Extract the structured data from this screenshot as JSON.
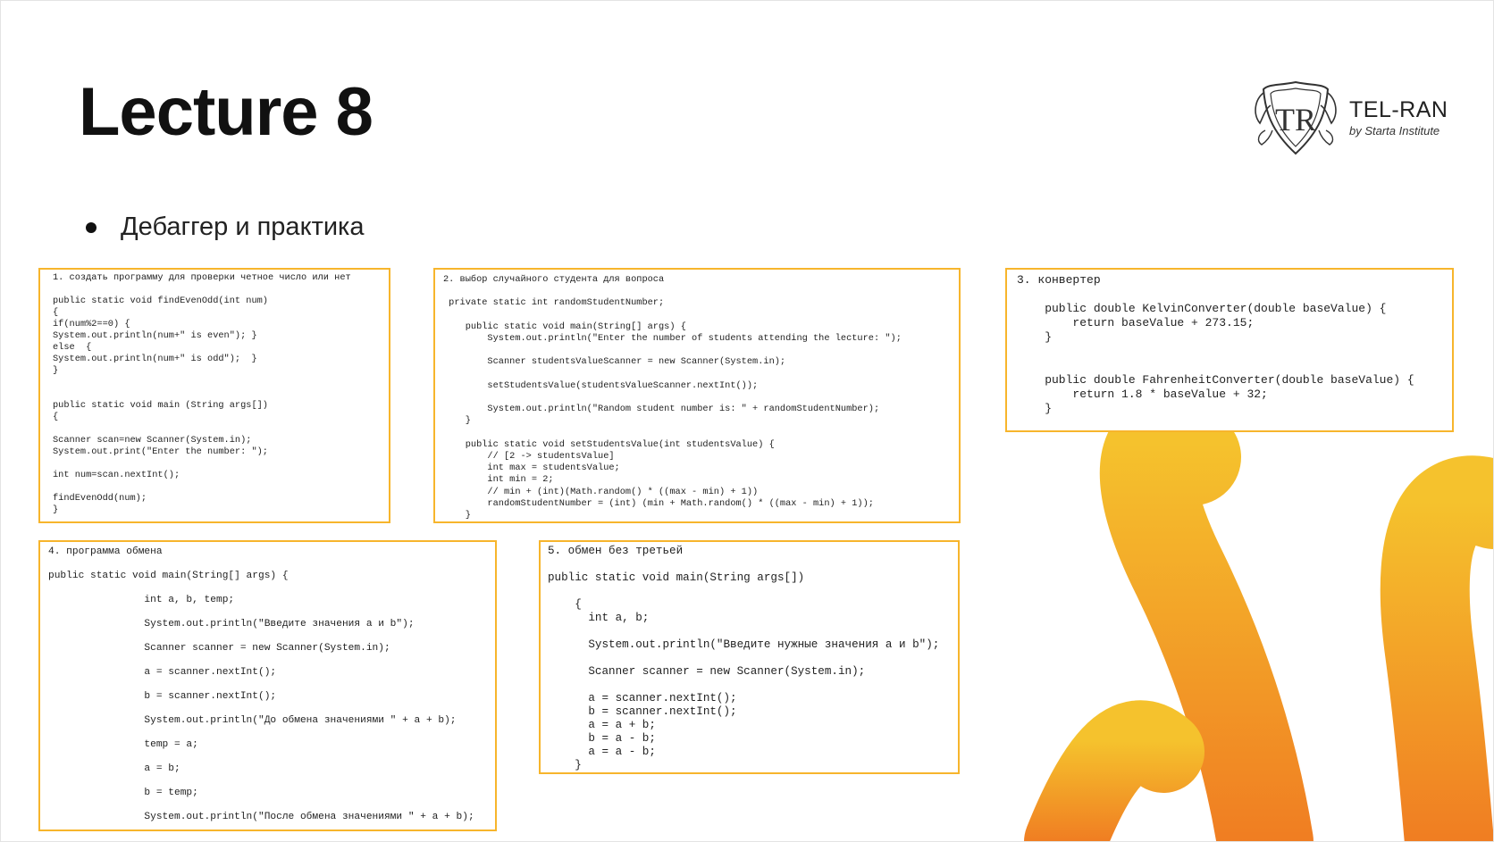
{
  "slide": {
    "title": "Lecture 8",
    "bullet": "Дебаггер и практика"
  },
  "logo": {
    "name": "TEL-RAN",
    "subtitle": "by Starta Institute",
    "emblem_letters": "TR",
    "icon": "tel-ran-crest-logo"
  },
  "colors": {
    "box_border": "#f7b52c",
    "accent_light": "#f5c22d",
    "accent_dark": "#f07d22"
  },
  "code_boxes": {
    "box1": "1. создать программу для проверки четное число или нет\n\npublic static void findEvenOdd(int num)\n{\nif(num%2==0) {\nSystem.out.println(num+\" is even\"); }\nelse  {\nSystem.out.println(num+\" is odd\");  }\n}\n\n\npublic static void main (String args[])\n{\n\nScanner scan=new Scanner(System.in);\nSystem.out.print(\"Enter the number: \");\n\nint num=scan.nextInt();\n\nfindEvenOdd(num);\n}",
    "box2": "2. выбор случайного студента для вопроса\n\n private static int randomStudentNumber;\n\n    public static void main(String[] args) {\n        System.out.println(\"Enter the number of students attending the lecture: \");\n\n        Scanner studentsValueScanner = new Scanner(System.in);\n\n        setStudentsValue(studentsValueScanner.nextInt());\n\n        System.out.println(\"Random student number is: \" + randomStudentNumber);\n    }\n\n    public static void setStudentsValue(int studentsValue) {\n        // [2 -> studentsValue]\n        int max = studentsValue;\n        int min = 2;\n        // min + (int)(Math.random() * ((max - min) + 1))\n        randomStudentNumber = (int) (min + Math.random() * ((max - min) + 1));\n    }",
    "box3": "3. конвертер\n\n    public double KelvinConverter(double baseValue) {\n        return baseValue + 273.15;\n    }\n\n\n    public double FahrenheitConverter(double baseValue) {\n        return 1.8 * baseValue + 32;\n    }",
    "box4": "4. программа обмена\n\npublic static void main(String[] args) {\n\n                int a, b, temp;\n\n                System.out.println(\"Введите значения a и b\");\n\n                Scanner scanner = new Scanner(System.in);\n\n                a = scanner.nextInt();\n\n                b = scanner.nextInt();\n\n                System.out.println(\"До обмена значениями \" + a + b);\n\n                temp = a;\n\n                a = b;\n\n                b = temp;\n\n                System.out.println(\"После обмена значениями \" + a + b);",
    "box5": "5. обмен без третьей\n\npublic static void main(String args[])\n\n    {\n      int a, b;\n\n      System.out.println(\"Введите нужные значения a и b\");\n\n      Scanner scanner = new Scanner(System.in);\n\n      a = scanner.nextInt();\n      b = scanner.nextInt();\n      a = a + b;\n      b = a - b;\n      a = a - b;\n    }"
  }
}
